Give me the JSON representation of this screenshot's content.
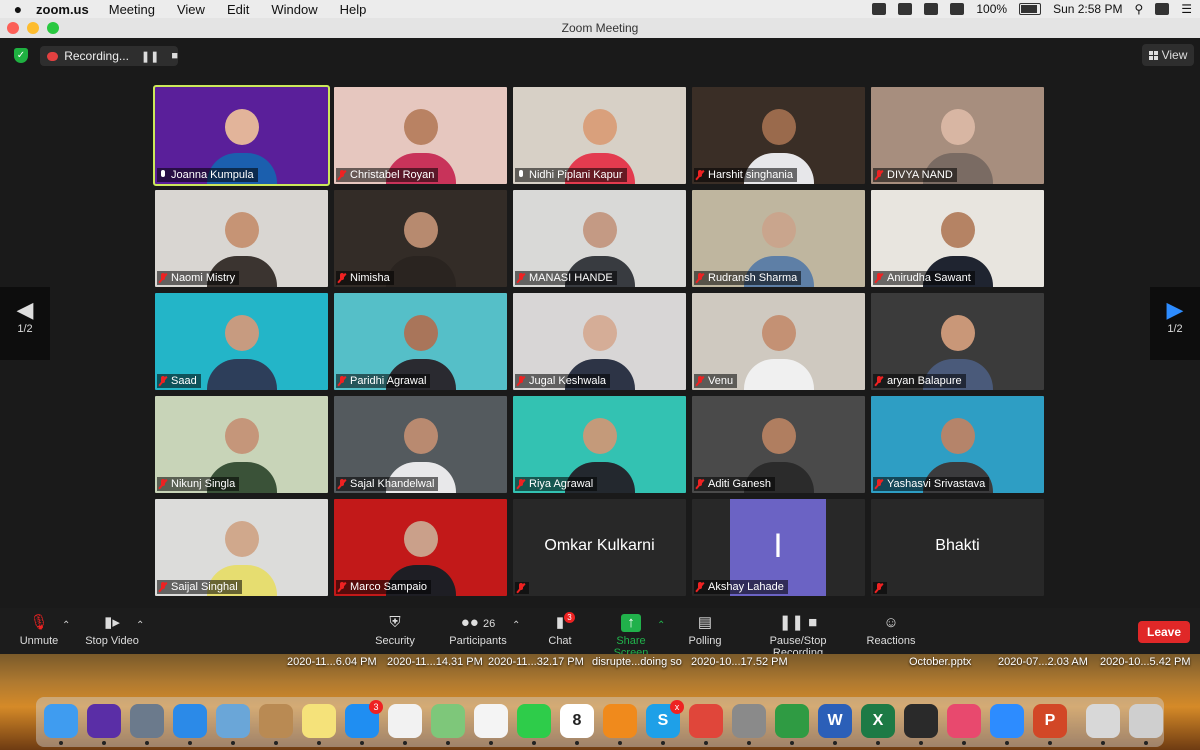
{
  "menubar": {
    "app_name": "zoom.us",
    "items": [
      "Meeting",
      "View",
      "Edit",
      "Window",
      "Help"
    ],
    "battery": "100%",
    "clock": "Sun 2:58 PM"
  },
  "window": {
    "title": "Zoom Meeting"
  },
  "top_controls": {
    "recording_label": "Recording...",
    "view_label": "View"
  },
  "pagination": {
    "prev_page": "1/2",
    "next_page": "1/2"
  },
  "participants": [
    {
      "name": "Joanna Kumpula",
      "muted": false,
      "active": true,
      "bg": "#5a1f9a",
      "skin": "#e2b49a",
      "shirt": "#1b5fae"
    },
    {
      "name": "Christabel Royan",
      "muted": true,
      "bg": "#e6c7bf",
      "skin": "#b98263",
      "shirt": "#c8335a"
    },
    {
      "name": "Nidhi Piplani Kapur",
      "muted": false,
      "bg": "#d7d0c6",
      "skin": "#d9a07c",
      "shirt": "#e33b4f"
    },
    {
      "name": "Harshit singhania",
      "muted": true,
      "bg": "#3a2e26",
      "skin": "#9a6a4c",
      "shirt": "#e7e7ea"
    },
    {
      "name": "DIVYA NAND",
      "muted": true,
      "bg": "#a78e7e",
      "skin": "#d8b6a3",
      "shirt": "#7a6b63"
    },
    {
      "name": "Naomi Mistry",
      "muted": true,
      "bg": "#d9d6d2",
      "skin": "#c69475",
      "shirt": "#3b3430"
    },
    {
      "name": "Nimisha",
      "muted": true,
      "bg": "#332c27",
      "skin": "#b78a6f",
      "shirt": "#2a2420"
    },
    {
      "name": "MANASI HANDE",
      "muted": true,
      "bg": "#d9d9d7",
      "skin": "#c49a84",
      "shirt": "#383b40"
    },
    {
      "name": "Rudransh Sharma",
      "muted": true,
      "bg": "#bfb69f",
      "skin": "#c9a58d",
      "shirt": "#5e7fa6"
    },
    {
      "name": "Anirudha Sawant",
      "muted": true,
      "bg": "#e8e5df",
      "skin": "#b58364",
      "shirt": "#1f2430"
    },
    {
      "name": "Saad",
      "muted": true,
      "bg": "#23b5c8",
      "skin": "#c79b80",
      "shirt": "#2d3e5a"
    },
    {
      "name": "Paridhi Agrawal",
      "muted": true,
      "bg": "#55bfc8",
      "skin": "#a9755a",
      "shirt": "#2a2a30"
    },
    {
      "name": "Jugal Keshwala",
      "muted": true,
      "bg": "#d8d6d6",
      "skin": "#d5ad97",
      "shirt": "#2d3446"
    },
    {
      "name": "Venu",
      "muted": true,
      "bg": "#cfc9c0",
      "skin": "#c49174",
      "shirt": "#f0f0f0"
    },
    {
      "name": "aryan Balapure",
      "muted": true,
      "bg": "#3b3b3b",
      "skin": "#c99778",
      "shirt": "#4a5a7a"
    },
    {
      "name": "Nikunj Singla",
      "muted": true,
      "bg": "#c8d4b8",
      "skin": "#c5967a",
      "shirt": "#3a5238"
    },
    {
      "name": "Sajal Khandelwal",
      "muted": true,
      "bg": "#545a5e",
      "skin": "#b98a70",
      "shirt": "#e8e8ea"
    },
    {
      "name": "Riya Agrawal",
      "muted": true,
      "bg": "#33c2b2",
      "skin": "#c49a7a",
      "shirt": "#23282e"
    },
    {
      "name": "Aditi Ganesh",
      "muted": true,
      "bg": "#4a4a4a",
      "skin": "#b07e60",
      "shirt": "#2b2b2b"
    },
    {
      "name": "Yashasvi Srivastava",
      "muted": true,
      "bg": "#2e9ec4",
      "skin": "#b5846a",
      "shirt": "#3b3b3d"
    },
    {
      "name": "Saijal Singhal",
      "muted": true,
      "bg": "#dcdcda",
      "skin": "#d0a88c",
      "shirt": "#e6dd70"
    },
    {
      "name": "Marco Sampaio",
      "muted": true,
      "bg": "#c21919",
      "skin": "#caa08a",
      "shirt": "#1e1e24"
    },
    {
      "name": "Omkar Kulkarni",
      "muted": true,
      "nocam": true
    },
    {
      "name": "Akshay Lahade",
      "muted": true,
      "avatar_letter": "I"
    },
    {
      "name": "Bhakti",
      "muted": true,
      "nocam": true
    }
  ],
  "toolbar": {
    "unmute": "Unmute",
    "stop_video": "Stop Video",
    "security": "Security",
    "participants": "Participants",
    "participants_count": "26",
    "chat": "Chat",
    "chat_badge": "3",
    "share_screen": "Share Screen",
    "polling": "Polling",
    "pause_stop_recording": "Pause/Stop Recording",
    "reactions": "Reactions",
    "leave": "Leave",
    "share_color": "#21b14b",
    "leave_color": "#e02828"
  },
  "desktop_files": [
    "2020-11...6.04 PM",
    "2020-11...14.31 PM",
    "2020-11...32.17 PM",
    "disrupte...doing so",
    "2020-10...17.52 PM",
    "October.pptx",
    "2020-07...2.03 AM",
    "2020-10...5.42 PM"
  ],
  "dock": [
    {
      "name": "finder-icon",
      "color": "#3f9cf0",
      "glyph": ""
    },
    {
      "name": "siri-icon",
      "color": "#5a2ea6",
      "glyph": ""
    },
    {
      "name": "launchpad-icon",
      "color": "#6b7a8c",
      "glyph": ""
    },
    {
      "name": "safari-icon",
      "color": "#2b8ae8",
      "glyph": ""
    },
    {
      "name": "mail-icon",
      "color": "#6aa6d8",
      "glyph": ""
    },
    {
      "name": "contacts-icon",
      "color": "#b98a53",
      "glyph": ""
    },
    {
      "name": "notes-icon",
      "color": "#f5e27a",
      "glyph": ""
    },
    {
      "name": "app-store-icon",
      "color": "#1f8ef2",
      "glyph": "",
      "badge": "3"
    },
    {
      "name": "reminders-icon",
      "color": "#f2f2f2",
      "glyph": ""
    },
    {
      "name": "maps-icon",
      "color": "#7ec77a",
      "glyph": ""
    },
    {
      "name": "photos-icon",
      "color": "#f4f4f4",
      "glyph": ""
    },
    {
      "name": "facetime-icon",
      "color": "#2ecc4a",
      "glyph": ""
    },
    {
      "name": "calendar-icon",
      "color": "#ffffff",
      "glyph": "8"
    },
    {
      "name": "books-icon",
      "color": "#f08a1c",
      "glyph": ""
    },
    {
      "name": "skype-icon",
      "color": "#1ea0e8",
      "glyph": "S",
      "badge": "x"
    },
    {
      "name": "chrome-icon",
      "color": "#e0463a",
      "glyph": ""
    },
    {
      "name": "system-preferences-icon",
      "color": "#8a8a8a",
      "glyph": ""
    },
    {
      "name": "adguard-icon",
      "color": "#2f9b43",
      "glyph": ""
    },
    {
      "name": "word-icon",
      "color": "#2b5fb8",
      "glyph": "W"
    },
    {
      "name": "excel-icon",
      "color": "#1d7a45",
      "glyph": "X"
    },
    {
      "name": "activity-monitor-icon",
      "color": "#2a2a2a",
      "glyph": ""
    },
    {
      "name": "itunes-icon",
      "color": "#e8496e",
      "glyph": ""
    },
    {
      "name": "zoom-icon",
      "color": "#2d8cff",
      "glyph": ""
    },
    {
      "name": "powerpoint-icon",
      "color": "#d24726",
      "glyph": "P"
    },
    {
      "name": "preview-icon",
      "color": "#d8d8d8",
      "glyph": ""
    },
    {
      "name": "trash-icon",
      "color": "#cfcfcf",
      "glyph": ""
    }
  ]
}
